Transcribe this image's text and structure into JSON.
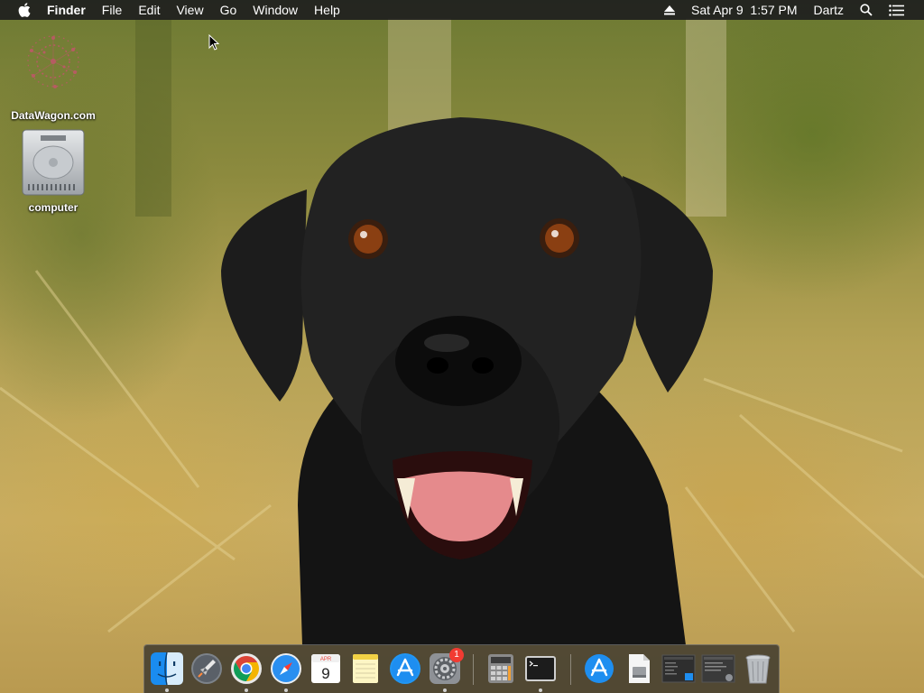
{
  "menubar": {
    "app_name": "Finder",
    "menus": [
      "File",
      "Edit",
      "View",
      "Go",
      "Window",
      "Help"
    ],
    "status": {
      "datetime": "Sat Apr 9  1:57 PM",
      "user": "Dartz",
      "icons": [
        "eject-icon",
        "spotlight-search-icon",
        "notification-center-icon"
      ]
    }
  },
  "desktop": {
    "icons": [
      {
        "label": "DataWagon.com",
        "icon": "datawagon-logo-icon"
      },
      {
        "label": "computer",
        "icon": "hard-drive-icon"
      }
    ]
  },
  "dock": {
    "items": [
      {
        "name": "Finder",
        "icon": "finder-icon",
        "running": true
      },
      {
        "name": "Launchpad",
        "icon": "launchpad-icon",
        "running": false
      },
      {
        "name": "Google Chrome",
        "icon": "chrome-icon",
        "running": true
      },
      {
        "name": "Safari",
        "icon": "safari-icon",
        "running": true
      },
      {
        "name": "Calendar",
        "icon": "calendar-icon",
        "running": false,
        "month": "APR",
        "day": "9"
      },
      {
        "name": "Notes",
        "icon": "notes-icon",
        "running": false
      },
      {
        "name": "App Store",
        "icon": "app-store-icon",
        "running": false
      },
      {
        "name": "System Preferences",
        "icon": "system-preferences-icon",
        "running": true,
        "badge": "1"
      },
      {
        "name": "Calculator",
        "icon": "calculator-icon",
        "running": false
      },
      {
        "name": "Terminal",
        "icon": "terminal-icon",
        "running": true
      },
      {
        "name": "App Store (download)",
        "icon": "app-store-folder-icon",
        "running": false
      },
      {
        "name": "Document",
        "icon": "document-icon",
        "running": false
      },
      {
        "name": "Window thumbnail 1",
        "icon": "window-thumbnail-icon",
        "running": false
      },
      {
        "name": "Window thumbnail 2",
        "icon": "window-thumbnail-icon",
        "running": false
      },
      {
        "name": "Trash",
        "icon": "trash-icon",
        "running": false
      }
    ]
  },
  "colors": {
    "menubar_bg": "#1e1e1e",
    "badge": "#f23b32",
    "accent_blue": "#1e8ef0"
  }
}
